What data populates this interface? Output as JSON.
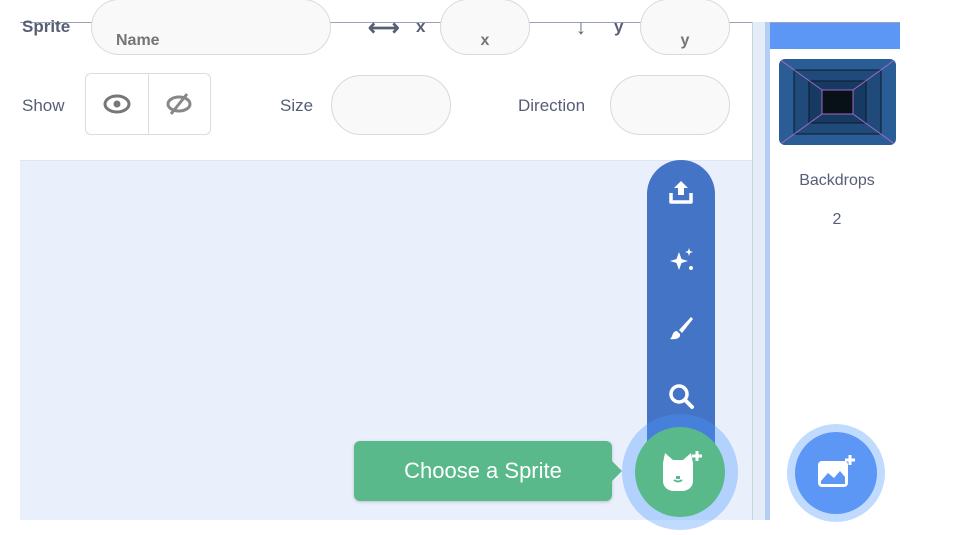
{
  "sprite_info": {
    "sprite_label": "Sprite",
    "name_placeholder": "Name",
    "x_label": "x",
    "x_placeholder": "x",
    "y_label": "y",
    "y_placeholder": "y",
    "show_label": "Show",
    "size_label": "Size",
    "size_value": "",
    "direction_label": "Direction",
    "direction_value": ""
  },
  "sprite_menu": {
    "items": [
      "upload-icon",
      "surprise-icon",
      "paint-icon",
      "search-icon"
    ],
    "tooltip": "Choose a Sprite"
  },
  "stage": {
    "backdrops_label": "Backdrops",
    "backdrops_count": "2"
  },
  "colors": {
    "menu_blue": "#4474c6",
    "sprite_green": "#59b98b",
    "stage_blue": "#5c97f5",
    "panel_bg": "#e9f0fb"
  }
}
